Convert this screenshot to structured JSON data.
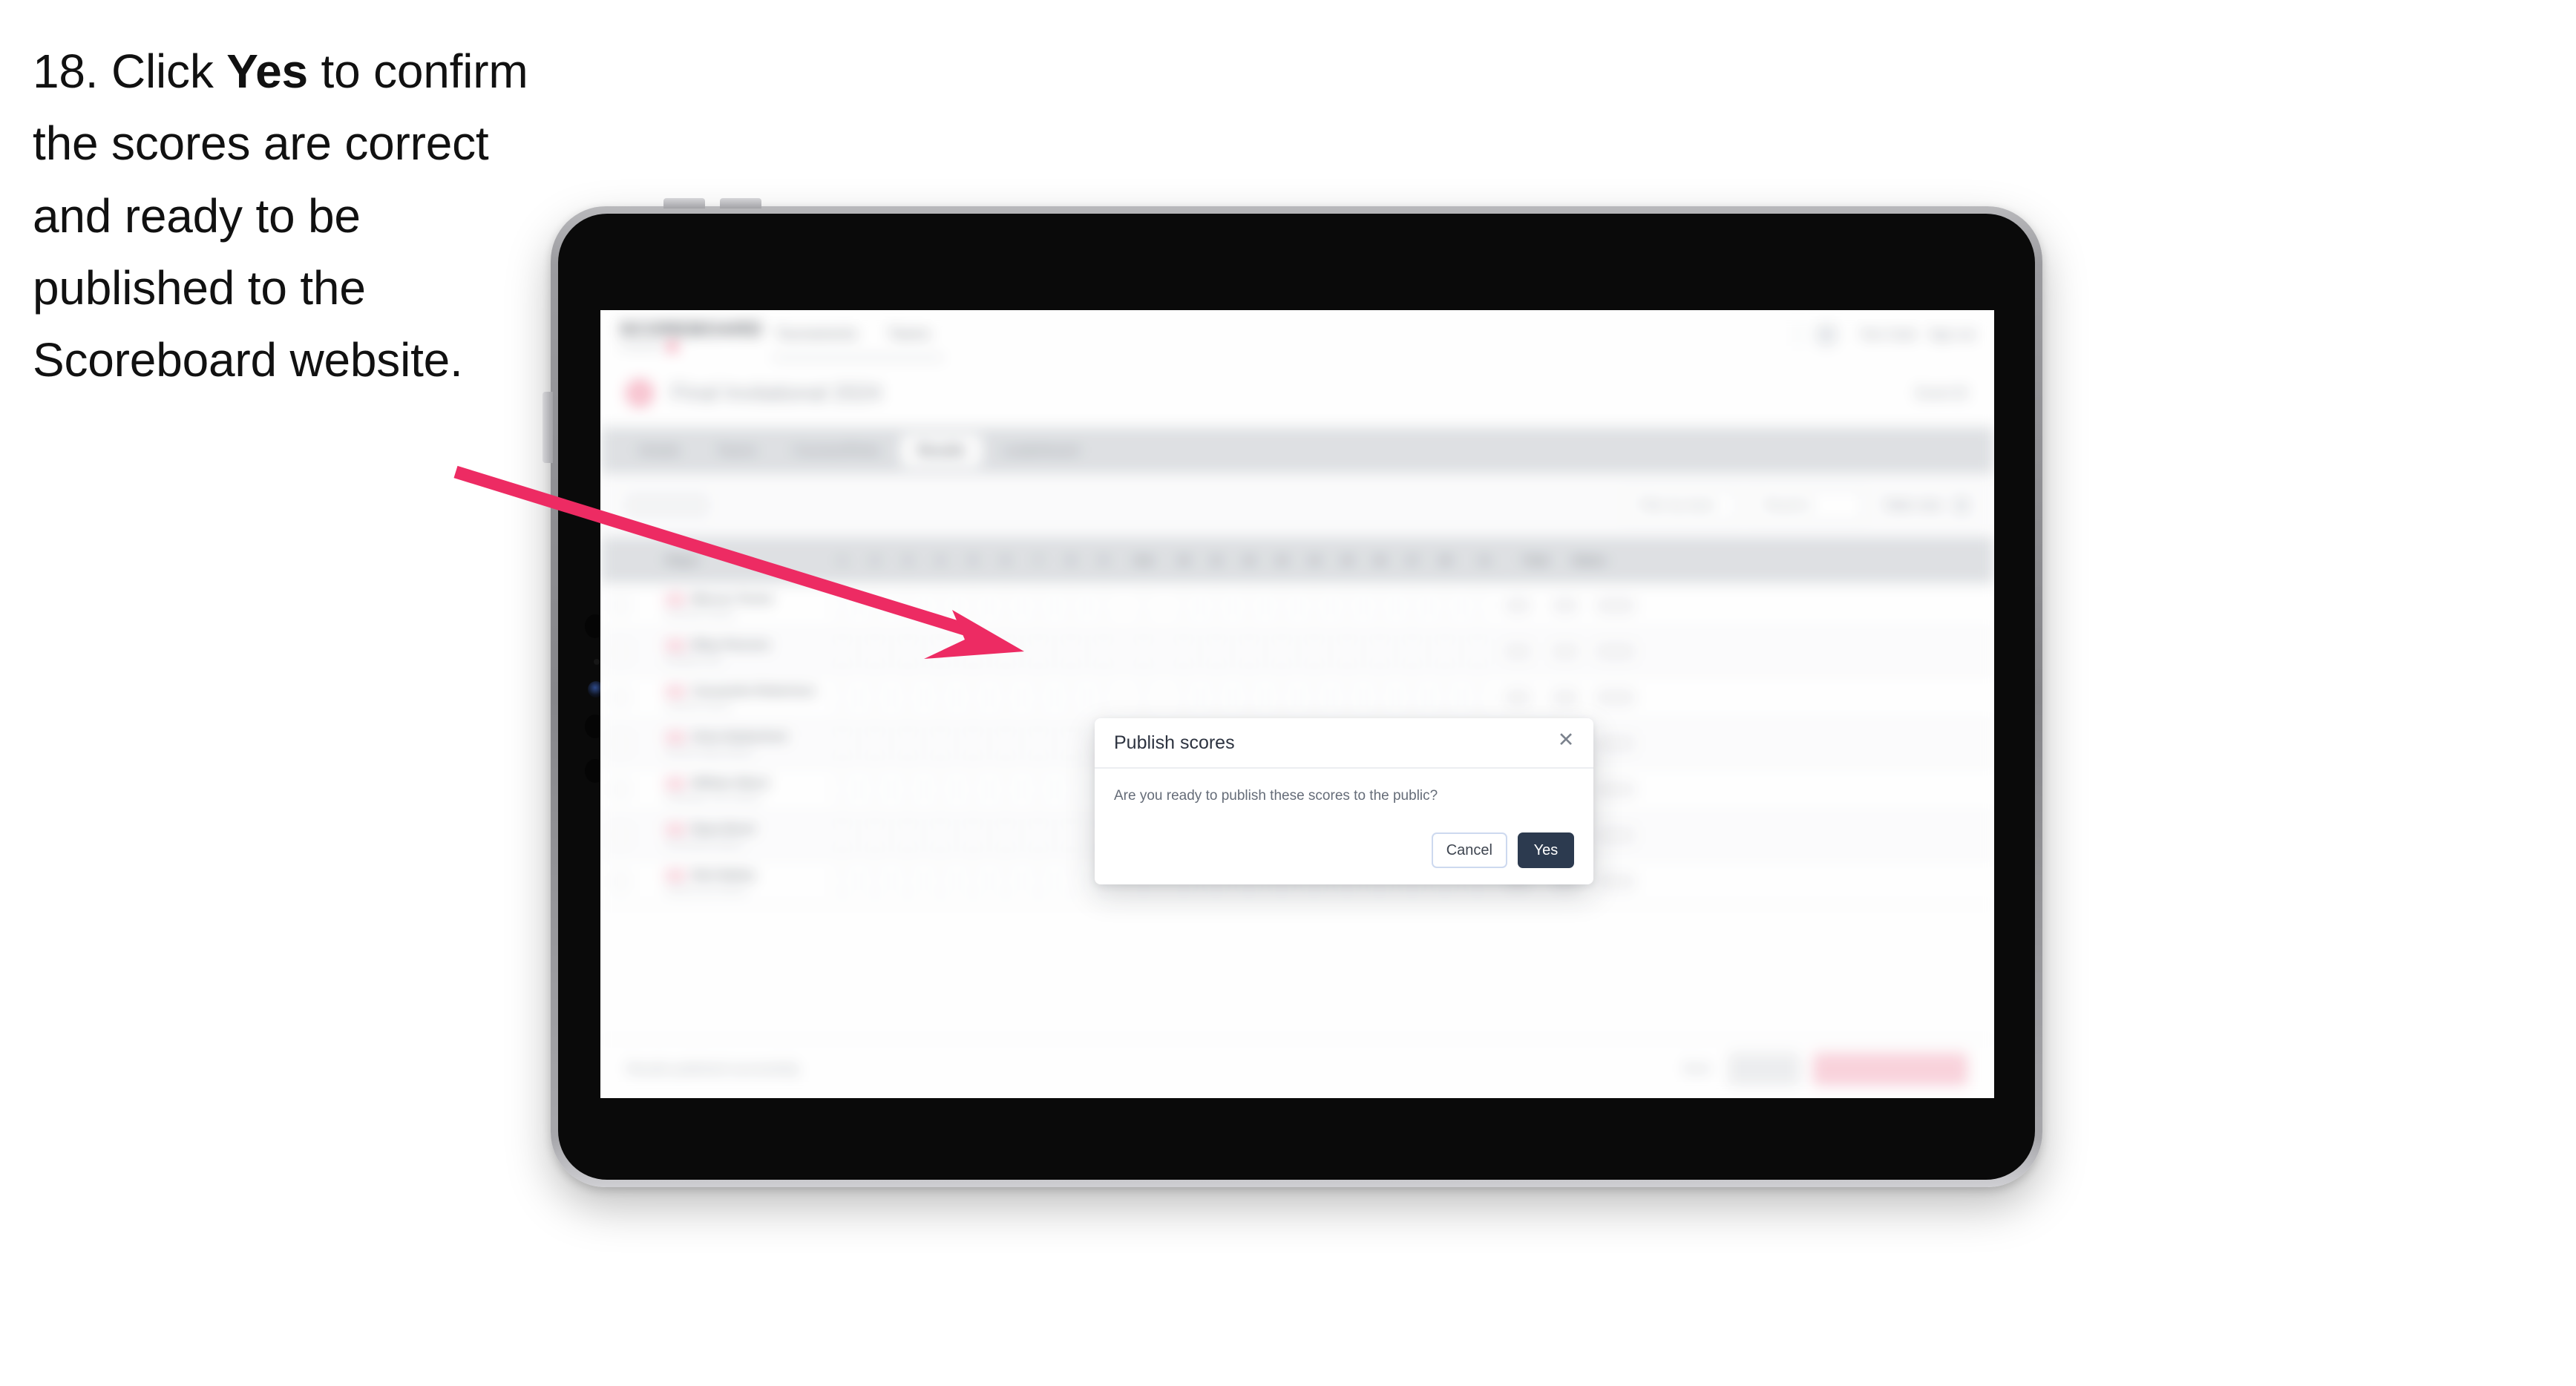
{
  "caption": {
    "step_number": "18.",
    "text_before": " Click ",
    "emphasis": "Yes",
    "text_after": " to confirm the scores are correct and ready to be published to the Scoreboard website."
  },
  "colors": {
    "arrow": "#ED2B63",
    "brand_accent": "#EC1B4B",
    "primary_button": "#2C3A4F",
    "cancel_border": "#CDD9EF",
    "tab_bar": "#D5D8DC",
    "publish_button": "#F9C6D2"
  },
  "app": {
    "logo": {
      "word": "SCOREBOARD",
      "sub": "competition",
      "dot_icon": "brand-square-icon"
    },
    "nav_links": [
      "Tournaments",
      "Teams"
    ],
    "user": {
      "avatar_icon": "user-avatar-icon",
      "name": "Tom Clark",
      "signout": "Sign out"
    },
    "page_header": {
      "icon": "event-circle-icon",
      "title": "Final Invitational",
      "title_suffix": "2024",
      "action": "Event ID"
    },
    "tabs": [
      {
        "label": "Details",
        "active": false
      },
      {
        "label": "Teams",
        "active": false
      },
      {
        "label": "Courses/Rinks",
        "active": false
      },
      {
        "label": "Results",
        "active": true
      },
      {
        "label": "Leaderboard",
        "active": false
      }
    ],
    "filter_bar": {
      "search_placeholder": "Search",
      "selects": [
        "Filter by team",
        "Round 1"
      ],
      "link": "Table view",
      "icon": "table-toggle-icon"
    },
    "table": {
      "headers": [
        "Player",
        "1",
        "2",
        "3",
        "4",
        "5",
        "6",
        "7",
        "8",
        "9",
        "Out",
        "10",
        "11",
        "12",
        "13",
        "14",
        "15",
        "16",
        "17",
        "18",
        "In",
        "Total",
        "Status"
      ],
      "rows": [
        {
          "flag": "country-flag-icon",
          "name": "Marcus Turner",
          "sub": "Northside Athletic",
          "status": "Verified"
        },
        {
          "flag": "country-flag-icon",
          "name": "Riley Parsons",
          "sub": "Eastfield Club",
          "status": "Verified"
        },
        {
          "flag": "country-flag-icon",
          "name": "Cassandra Robertson",
          "sub": "Lakeview Sports",
          "status": "Verified"
        },
        {
          "flag": "country-flag-icon",
          "name": "Chris Rutherford",
          "sub": "Summit Valley Athletic",
          "status": "Verified"
        },
        {
          "flag": "country-flag-icon",
          "name": "William Nkosi",
          "sub": "Redbridge Town Athletic",
          "status": "Verified"
        },
        {
          "flag": "country-flag-icon",
          "name": "Ryan Brent",
          "sub": "Greenlands Athletic",
          "status": "Verified"
        },
        {
          "flag": "country-flag-icon",
          "name": "Nick Bailey",
          "sub": "Harbourview Athletic",
          "status": "Verified"
        }
      ]
    },
    "footer": {
      "note": "Results published successfully.",
      "link": "Back",
      "secondary_button": "Save all",
      "primary_button": "Publish scores to public"
    }
  },
  "modal": {
    "title": "Publish scores",
    "close_icon": "close-icon",
    "message": "Are you ready to publish these scores to the public?",
    "cancel_label": "Cancel",
    "confirm_label": "Yes"
  },
  "device": {
    "chrome": {
      "volume_up_icon": "volume-up-button",
      "volume_down_icon": "volume-down-button",
      "power_icon": "power-button",
      "camera_icon": "front-camera-icon"
    }
  }
}
